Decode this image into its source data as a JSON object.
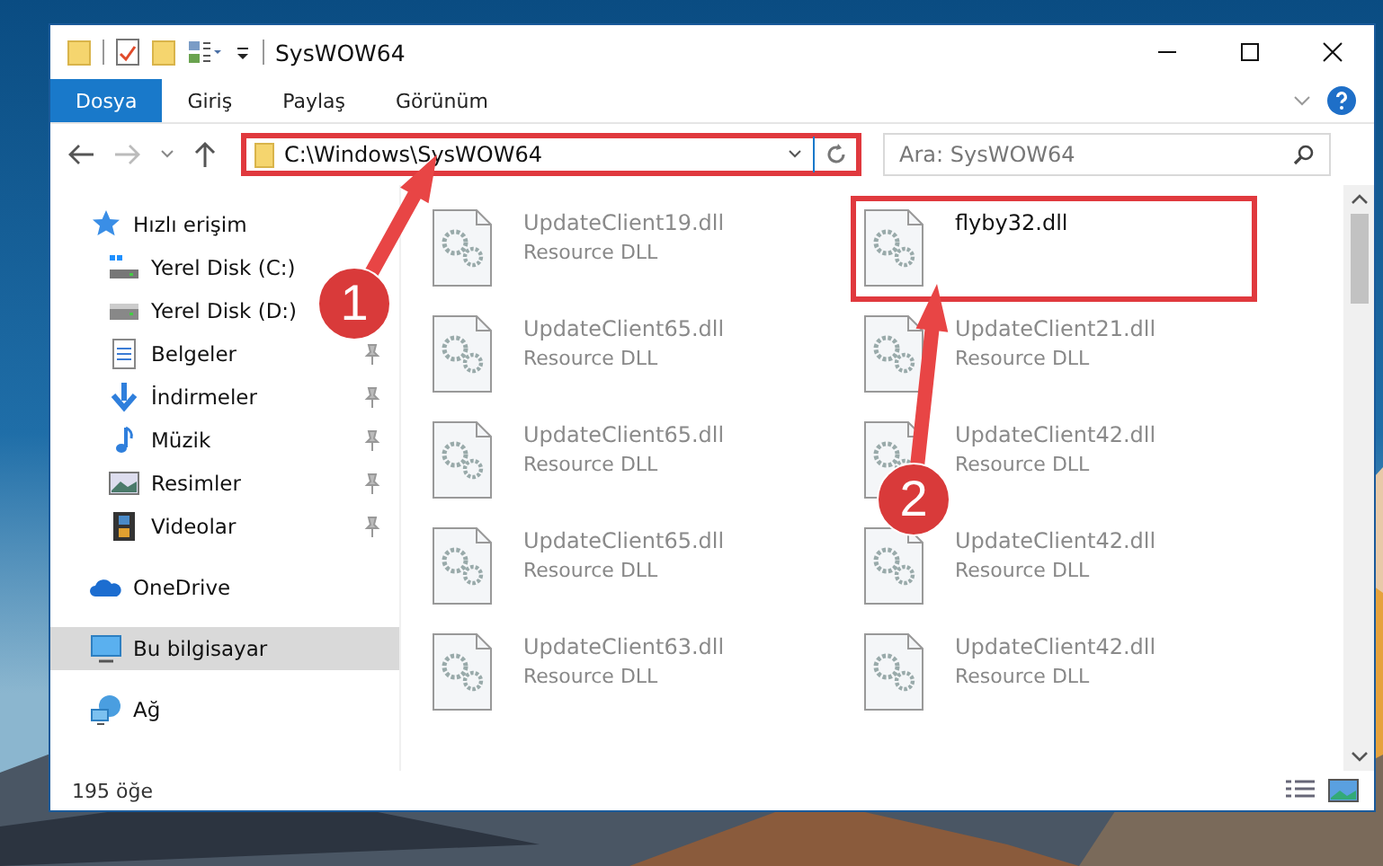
{
  "window": {
    "title": "SysWOW64"
  },
  "ribbon_tabs": [
    {
      "label": "Dosya",
      "selected": true
    },
    {
      "label": "Giriş",
      "selected": false
    },
    {
      "label": "Paylaş",
      "selected": false
    },
    {
      "label": "Görünüm",
      "selected": false
    }
  ],
  "address_bar": {
    "value": "C:\\Windows\\SysWOW64",
    "highlighted": true
  },
  "search": {
    "placeholder": "Ara: SysWOW64"
  },
  "sidebar": {
    "items": [
      {
        "label": "Hızlı erişim",
        "kind": "star",
        "selected": false,
        "children": [
          {
            "label": "Yerel Disk (C:)",
            "kind": "drive-c",
            "pinned": false,
            "selected": false
          },
          {
            "label": "Yerel Disk (D:)",
            "kind": "drive",
            "pinned": false,
            "selected": false
          },
          {
            "label": "Belgeler",
            "kind": "document",
            "pinned": true,
            "selected": false
          },
          {
            "label": "İndirmeler",
            "kind": "download",
            "pinned": true,
            "selected": false
          },
          {
            "label": "Müzik",
            "kind": "music",
            "pinned": true,
            "selected": false
          },
          {
            "label": "Resimler",
            "pinned": true,
            "selected": false
          },
          {
            "label": "Videolar",
            "kind": "video",
            "pinned": true,
            "selected": false
          }
        ]
      },
      {
        "label": "OneDrive",
        "kind": "cloud",
        "selected": false
      },
      {
        "label": "Bu bilgisayar",
        "kind": "computer",
        "selected": true
      },
      {
        "label": "Ağ",
        "kind": "network",
        "selected": false
      }
    ]
  },
  "files": [
    {
      "name": "UpdateClient19.dll",
      "type": "Resource DLL",
      "highlighted": false
    },
    {
      "name": "flyby32.dll",
      "highlighted": true
    },
    {
      "name": "UpdateClient65.dll",
      "type": "Resource DLL",
      "highlighted": false
    },
    {
      "name": "UpdateClient21.dll",
      "type": "Resource DLL",
      "highlighted": false
    },
    {
      "name": "UpdateClient65.dll",
      "type": "Resource DLL",
      "highlighted": false
    },
    {
      "name": "UpdateClient42.dll",
      "type": "Resource DLL",
      "highlighted": false
    },
    {
      "name": "UpdateClient65.dll",
      "type": "Resource DLL",
      "highlighted": false
    },
    {
      "name": "UpdateClient42.dll",
      "type": "Resource DLL",
      "highlighted": false
    },
    {
      "name": "UpdateClient63.dll",
      "type": "Resource DLL",
      "highlighted": false
    },
    {
      "name": "UpdateClient42.dll",
      "type": "Resource DLL",
      "highlighted": false
    }
  ],
  "status_bar": {
    "count": "195 öğe"
  },
  "callouts": [
    {
      "number": "1"
    },
    {
      "number": "2"
    }
  ]
}
